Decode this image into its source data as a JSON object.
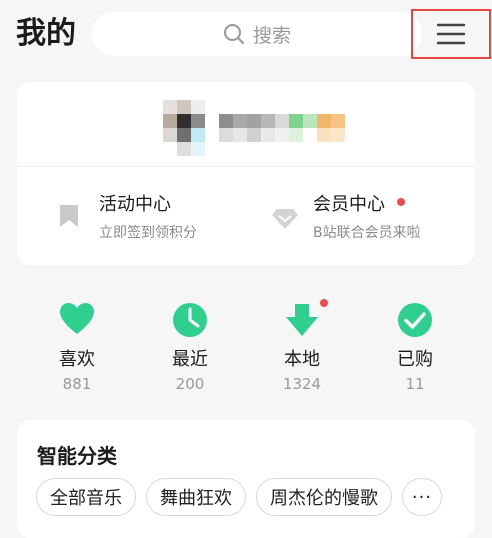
{
  "header": {
    "title": "我的",
    "search_placeholder": "搜索"
  },
  "profile": {
    "name_obscured": true
  },
  "entries": [
    {
      "title": "活动中心",
      "subtitle": "立即签到领积分",
      "icon": "bookmark-icon"
    },
    {
      "title": "会员中心",
      "subtitle": "B站联合会员来啦",
      "icon": "diamond-icon",
      "badge_dot": true
    }
  ],
  "quick": [
    {
      "label": "喜欢",
      "count": "881",
      "icon": "heart-icon"
    },
    {
      "label": "最近",
      "count": "200",
      "icon": "clock-icon"
    },
    {
      "label": "本地",
      "count": "1324",
      "icon": "download-icon",
      "badge_dot": true
    },
    {
      "label": "已购",
      "count": "11",
      "icon": "check-icon"
    }
  ],
  "categories": {
    "title": "智能分类",
    "chips": [
      "全部音乐",
      "舞曲狂欢",
      "周杰伦的慢歌"
    ],
    "more_label": "···"
  },
  "colors": {
    "accent": "#2ecf8f",
    "badge": "#f04b4b",
    "highlight_border": "#e5463d"
  }
}
